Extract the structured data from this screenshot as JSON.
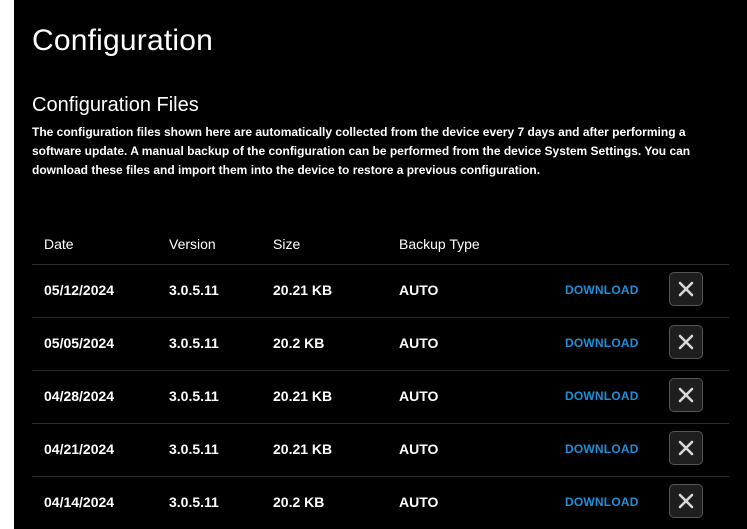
{
  "page": {
    "title": "Configuration"
  },
  "section": {
    "title": "Configuration Files",
    "description": "The configuration files shown here are automatically collected from the device every 7 days and after performing a software update. A manual backup of the configuration can be performed from the device System Settings. You can download these files and import them into the device to restore a previous configuration."
  },
  "table": {
    "headers": {
      "date": "Date",
      "version": "Version",
      "size": "Size",
      "backup_type": "Backup Type"
    },
    "rows": [
      {
        "date": "05/12/2024",
        "version": "3.0.5.11",
        "size": "20.21 KB",
        "backup_type": "AUTO",
        "action": "DOWNLOAD"
      },
      {
        "date": "05/05/2024",
        "version": "3.0.5.11",
        "size": "20.2 KB",
        "backup_type": "AUTO",
        "action": "DOWNLOAD"
      },
      {
        "date": "04/28/2024",
        "version": "3.0.5.11",
        "size": "20.21 KB",
        "backup_type": "AUTO",
        "action": "DOWNLOAD"
      },
      {
        "date": "04/21/2024",
        "version": "3.0.5.11",
        "size": "20.21 KB",
        "backup_type": "AUTO",
        "action": "DOWNLOAD"
      },
      {
        "date": "04/14/2024",
        "version": "3.0.5.11",
        "size": "20.2 KB",
        "backup_type": "AUTO",
        "action": "DOWNLOAD"
      }
    ]
  },
  "icons": {
    "delete": "close-icon"
  },
  "colors": {
    "background": "#000000",
    "text": "#ffffff",
    "link": "#1e8fd8",
    "button_border": "#555555"
  }
}
